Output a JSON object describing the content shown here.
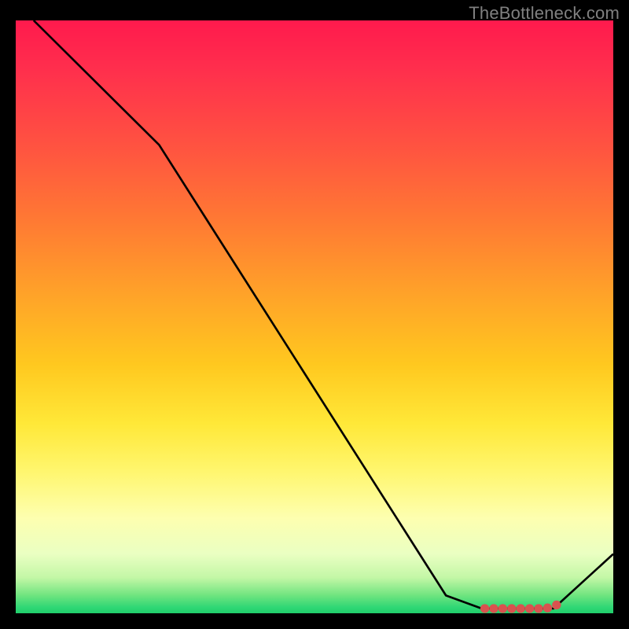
{
  "watermark": {
    "text": "TheBottleneck.com"
  },
  "chart_data": {
    "type": "line",
    "title": "",
    "xlabel": "",
    "ylabel": "",
    "xlim": [
      0,
      100
    ],
    "ylim": [
      0,
      100
    ],
    "grid": false,
    "background_gradient": {
      "direction": "vertical",
      "top_value": 100,
      "bottom_value": 0,
      "stops": [
        {
          "pos": 0,
          "color": "#ff1a4d"
        },
        {
          "pos": 50,
          "color": "#ffc81f"
        },
        {
          "pos": 85,
          "color": "#fdffb0"
        },
        {
          "pos": 100,
          "color": "#20cf6b"
        }
      ]
    },
    "series": [
      {
        "name": "bottleneck-curve",
        "color": "#000000",
        "points": [
          {
            "x": 3,
            "y": 100
          },
          {
            "x": 24,
            "y": 79
          },
          {
            "x": 72,
            "y": 3
          },
          {
            "x": 78,
            "y": 0.8
          },
          {
            "x": 90,
            "y": 0.8
          },
          {
            "x": 100,
            "y": 10
          }
        ]
      }
    ],
    "markers": {
      "name": "minimum-band",
      "color": "#d9534f",
      "points": [
        {
          "x": 78.5,
          "y": 0.8
        },
        {
          "x": 80,
          "y": 0.8
        },
        {
          "x": 81.5,
          "y": 0.8
        },
        {
          "x": 83,
          "y": 0.8
        },
        {
          "x": 84.5,
          "y": 0.8
        },
        {
          "x": 86,
          "y": 0.8
        },
        {
          "x": 87.5,
          "y": 0.8
        },
        {
          "x": 89,
          "y": 0.9
        },
        {
          "x": 90.5,
          "y": 1.4
        }
      ]
    }
  }
}
